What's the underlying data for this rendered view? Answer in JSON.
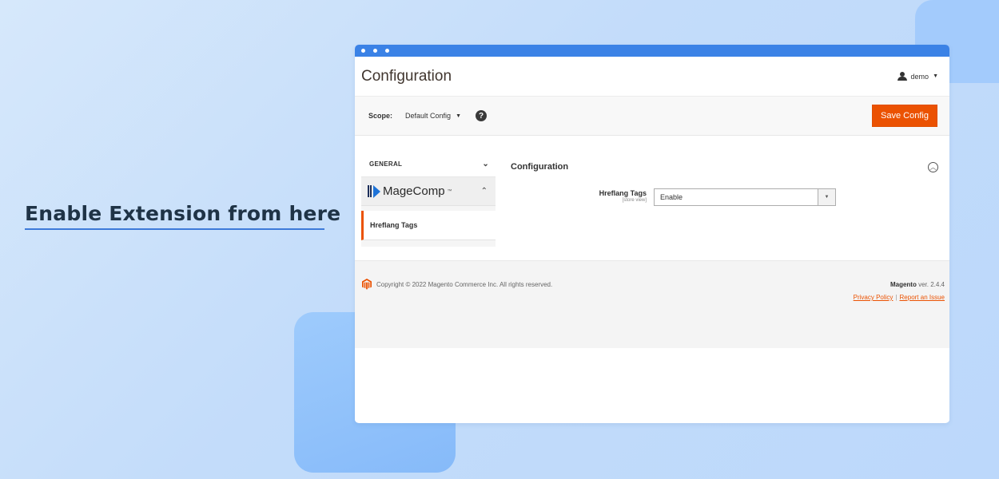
{
  "banner": {
    "headline": "Enable Extension from here"
  },
  "colors": {
    "accent": "#eb5202",
    "titlebar": "#3b82e6",
    "headline_underline": "#3d7ad9"
  },
  "header": {
    "title": "Configuration",
    "user_name": "demo"
  },
  "scope": {
    "label": "Scope:",
    "value": "Default Config"
  },
  "toolbar": {
    "save_label": "Save Config"
  },
  "sidebar": {
    "general_label": "GENERAL",
    "brand_name": "MageComp",
    "brand_tm": "™",
    "active_item": "Hreflang Tags"
  },
  "section": {
    "title": "Configuration",
    "field_label": "Hreflang Tags",
    "field_scope": "[store view]",
    "field_value": "Enable"
  },
  "footer": {
    "copyright": "Copyright © 2022 Magento Commerce Inc. All rights reserved.",
    "brand": "Magento",
    "version": "ver. 2.4.4",
    "privacy_link": "Privacy Policy",
    "separator": "|",
    "report_link": "Report an Issue"
  }
}
